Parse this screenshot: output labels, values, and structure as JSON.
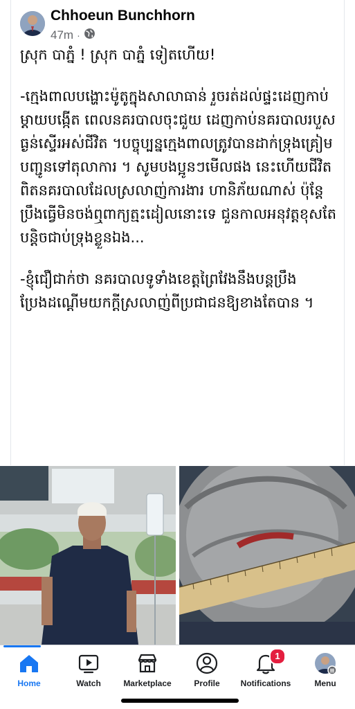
{
  "post": {
    "author": "Chhoeun Bunchhorn",
    "time": "47m",
    "separator": "·",
    "audience_icon": "globe-icon",
    "headline": "ស្រុក បាភ្នំ ! ស្រុក បាភ្នំ ទៀតហើយ!",
    "paragraphs": [
      "-ក្មេងពាលបង្ហោះម៉ូតូក្នុងសាលាធាន់ រួចរត់ដល់ផ្ទះដេញកាប់ម្តាយបង្កើត ពេលនគរបាលចុះជួយ ដេញកាប់នគរបាលរបួសធ្ងន់ស្ទើរអស់ជីវិត ។បច្ចុប្បន្នក្មេងពាលត្រូវបានដាក់ទ្រុងគ្រៀមបញ្ជូនទៅតុលាការ ។ សូមបងប្អូនៗមើលផង នេះហើយជីវិតពិតនគរបាលដែលស្រលាញ់ការងារ ហានិភ័យណាស់ ប៉ុន្តែប្រឹងធ្វើមិនចង់ឮពាក្យត្មះដៀលនោះទេ ជួនកាលអនុវត្តខុសតែបន្តិចជាប់ទ្រុងខ្លួនឯង...",
      "-ខ្ញុំជឿជាក់ថា នគរបាលទូទាំងខេត្តព្រៃវែងនឹងបន្តប្រឹងប្រែងដណ្តើមយកក្តីស្រលាញ់ពីប្រជាជនឱ្យខាងតែបាន ។"
    ]
  },
  "photos": [
    {
      "name": "injured-officer-photo"
    },
    {
      "name": "head-wound-photo"
    }
  ],
  "tabbar": {
    "tabs": [
      {
        "label": "Home",
        "icon": "home-icon",
        "active": true
      },
      {
        "label": "Watch",
        "icon": "watch-icon",
        "active": false
      },
      {
        "label": "Marketplace",
        "icon": "marketplace-icon",
        "active": false
      },
      {
        "label": "Profile",
        "icon": "profile-icon",
        "active": false
      },
      {
        "label": "Notifications",
        "icon": "bell-icon",
        "active": false,
        "badge": "1"
      },
      {
        "label": "Menu",
        "icon": "menu-avatar-icon",
        "active": false
      }
    ]
  },
  "colors": {
    "accent": "#1877f2",
    "badge": "#e41e3f",
    "meta": "#65676b"
  }
}
